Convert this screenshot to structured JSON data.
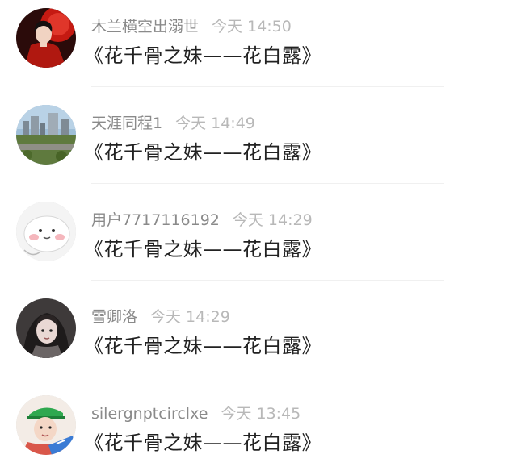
{
  "comments": [
    {
      "username": "木兰横空出溺世",
      "time": "今天 14:50",
      "text": "《花千骨之妹——花白露》",
      "avatar_icon": "user-avatar-red-dress"
    },
    {
      "username": "天涯同程1",
      "time": "今天 14:49",
      "text": "《花千骨之妹——花白露》",
      "avatar_icon": "user-avatar-city-skyline"
    },
    {
      "username": "用户7717116192",
      "time": "今天 14:29",
      "text": "《花千骨之妹——花白露》",
      "avatar_icon": "user-avatar-cartoon-blob"
    },
    {
      "username": "雪卿洛",
      "time": "今天 14:29",
      "text": "《花千骨之妹——花白露》",
      "avatar_icon": "user-avatar-dark-portrait"
    },
    {
      "username": "silergnptcirclxe",
      "time": "今天 13:45",
      "text": "《花千骨之妹——花白露》",
      "avatar_icon": "user-avatar-green-cap"
    }
  ],
  "colors": {
    "username": "#8a8a8a",
    "timestamp": "#b8b8b8",
    "message": "#222222",
    "divider": "#f0f0f0"
  }
}
